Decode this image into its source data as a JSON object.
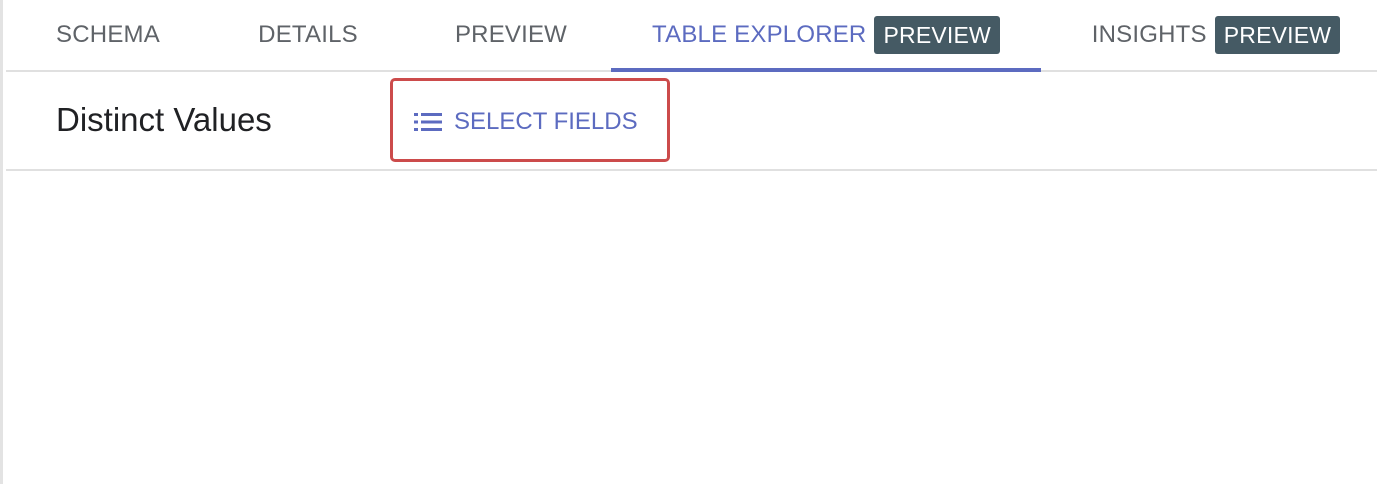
{
  "tabs": [
    {
      "label": "SCHEMA",
      "active": false
    },
    {
      "label": "DETAILS",
      "active": false
    },
    {
      "label": "PREVIEW",
      "active": false
    },
    {
      "label": "TABLE EXPLORER",
      "active": true,
      "badge": "PREVIEW"
    },
    {
      "label": "INSIGHTS",
      "active": false,
      "badge": "PREVIEW"
    }
  ],
  "toolbar": {
    "title": "Distinct Values",
    "select_fields_label": "SELECT FIELDS",
    "select_fields_icon": "list-icon"
  },
  "colors": {
    "accent": "#5c6bc0",
    "badge_bg": "#455a64",
    "highlight": "#cc4b4b"
  }
}
